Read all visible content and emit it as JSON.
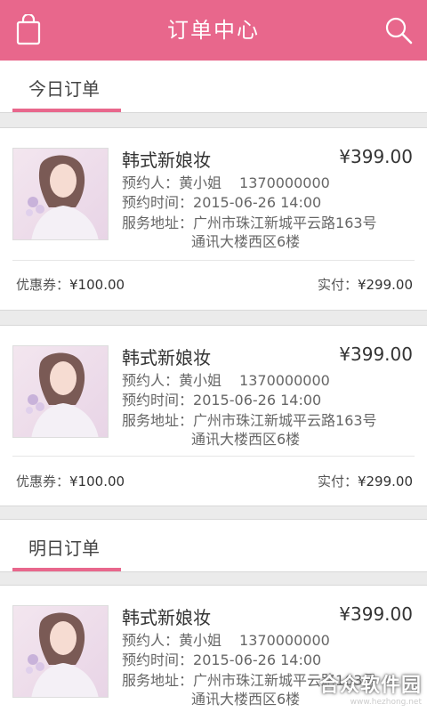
{
  "header": {
    "title": "订单中心",
    "bag_icon": "shopping-bag-icon",
    "search_icon": "search-icon"
  },
  "sections": {
    "today": {
      "label": "今日订单"
    },
    "tomorrow": {
      "label": "明日订单"
    }
  },
  "orders": [
    {
      "name": "韩式新娘妆",
      "price": "¥399.00",
      "contact_label": "预约人：",
      "contact_name": "黄小姐",
      "contact_phone": "1370000000",
      "time_label": "预约时间：",
      "time": "2015-06-26 14:00",
      "addr_label": "服务地址：",
      "addr_line1": "广州市珠江新城平云路163号",
      "addr_line2": "通讯大楼西区6楼",
      "coupon_label": "优惠券：",
      "coupon_amount": "¥100.00",
      "paid_label": "实付：",
      "paid_amount": "¥299.00"
    },
    {
      "name": "韩式新娘妆",
      "price": "¥399.00",
      "contact_label": "预约人：",
      "contact_name": "黄小姐",
      "contact_phone": "1370000000",
      "time_label": "预约时间：",
      "time": "2015-06-26 14:00",
      "addr_label": "服务地址：",
      "addr_line1": "广州市珠江新城平云路163号",
      "addr_line2": "通讯大楼西区6楼",
      "coupon_label": "优惠券：",
      "coupon_amount": "¥100.00",
      "paid_label": "实付：",
      "paid_amount": "¥299.00"
    },
    {
      "name": "韩式新娘妆",
      "price": "¥399.00",
      "contact_label": "预约人：",
      "contact_name": "黄小姐",
      "contact_phone": "1370000000",
      "time_label": "预约时间：",
      "time": "2015-06-26 14:00",
      "addr_label": "服务地址：",
      "addr_line1": "广州市珠江新城平云路163号",
      "addr_line2": "通讯大楼西区6楼"
    }
  ],
  "watermark": {
    "title": "合众软件园",
    "url": "www.hezhong.net"
  },
  "colors": {
    "brand": "#e8678c",
    "background": "#ebebeb"
  }
}
